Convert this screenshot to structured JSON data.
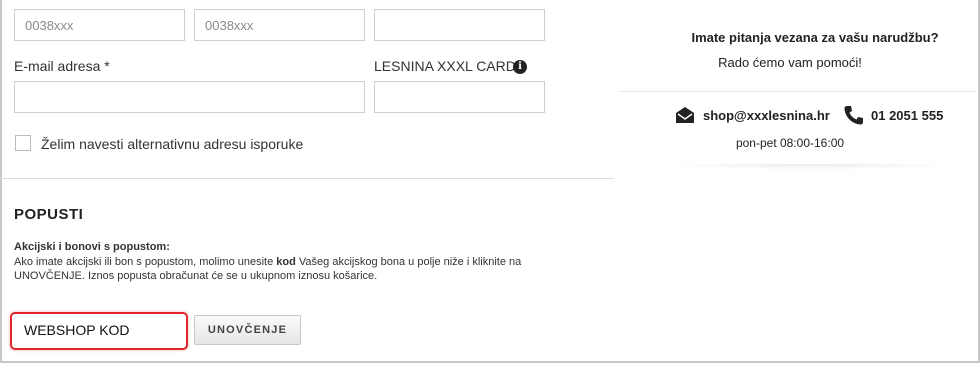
{
  "form": {
    "phone1_placeholder": "0038xxx",
    "phone2_placeholder": "0038xxx",
    "field3_value": "",
    "email_label": "E-mail adresa *",
    "email_value": "",
    "card_label": "LESNINA XXXL CARD",
    "card_info_icon": "i",
    "card_value": "",
    "alt_address_label": "Želim navesti alternativnu adresu isporuke"
  },
  "discounts": {
    "title": "POPUSTI",
    "subtitle": "Akcijski i bonovi s popustom:",
    "desc_part1": "Ako imate akcijski ili bon s popustom, molimo unesite ",
    "desc_bold": "kod",
    "desc_part2": " Vašeg akcijskog bona u polje niže i kliknite na UNOVČENJE. Iznos popusta obračunat će se u ukupnom iznosu košarice.",
    "code_value": "WEBSHOP KOD",
    "redeem_button": "UNOVČENJE"
  },
  "help": {
    "question": "Imate pitanja vezana za vašu narudžbu?",
    "offer": "Rado ćemo vam pomoći!",
    "email": "shop@xxxlesnina.hr",
    "phone": "01 2051 555",
    "hours": "pon-pet 08:00-16:00"
  },
  "colors": {
    "highlight": "#e0262b",
    "border": "#cfcfcf",
    "text": "#222222"
  }
}
